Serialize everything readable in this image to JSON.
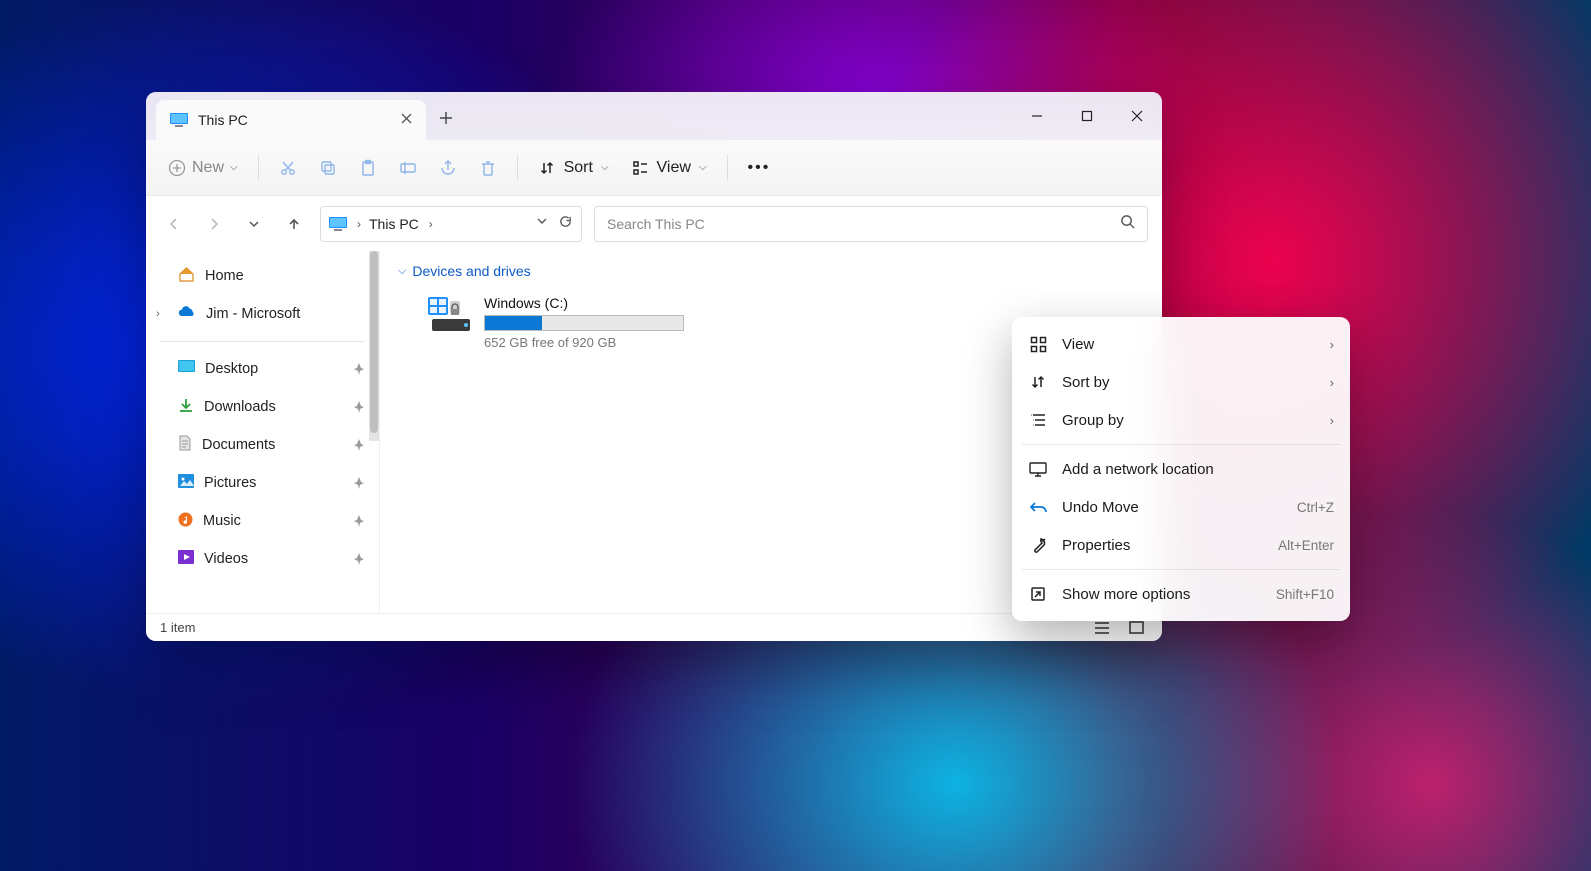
{
  "tab": {
    "title": "This PC"
  },
  "toolbar": {
    "new_label": "New",
    "sort_label": "Sort",
    "view_label": "View"
  },
  "address": {
    "location": "This PC"
  },
  "search": {
    "placeholder": "Search This PC"
  },
  "sidebar": {
    "home": "Home",
    "onedrive": "Jim - Microsoft",
    "quick": [
      {
        "label": "Desktop"
      },
      {
        "label": "Downloads"
      },
      {
        "label": "Documents"
      },
      {
        "label": "Pictures"
      },
      {
        "label": "Music"
      },
      {
        "label": "Videos"
      }
    ]
  },
  "content": {
    "group_label": "Devices and drives",
    "drive": {
      "name": "Windows  (C:)",
      "free_text": "652 GB free of 920 GB",
      "used_pct": 29
    }
  },
  "status": {
    "item_count": "1 item"
  },
  "context_menu": {
    "items": [
      {
        "label": "View",
        "submenu": true
      },
      {
        "label": "Sort by",
        "submenu": true
      },
      {
        "label": "Group by",
        "submenu": true
      },
      {
        "sep": true
      },
      {
        "label": "Add a network location"
      },
      {
        "label": "Undo Move",
        "accel": "Ctrl+Z"
      },
      {
        "label": "Properties",
        "accel": "Alt+Enter"
      },
      {
        "sep": true
      },
      {
        "label": "Show more options",
        "accel": "Shift+F10"
      }
    ]
  }
}
